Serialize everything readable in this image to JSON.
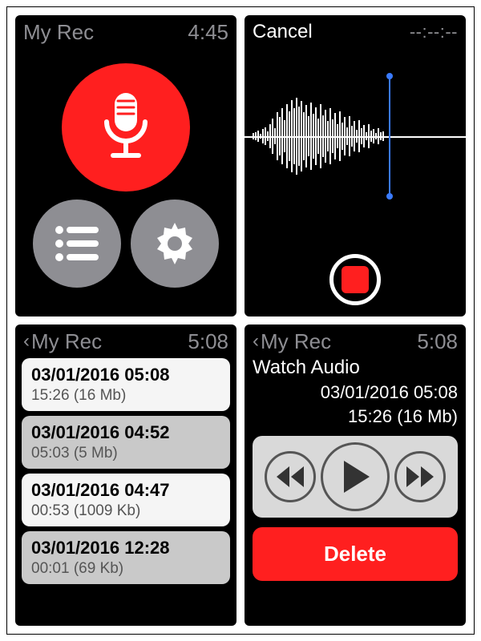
{
  "colors": {
    "accent": "#ff1f1f",
    "grey": "#8e8e93",
    "playhead": "#3a7bff"
  },
  "screen1": {
    "title": "My Rec",
    "time": "4:45",
    "buttons": {
      "record": "record-mic",
      "list": "list",
      "settings": "gear"
    }
  },
  "screen2": {
    "cancel": "Cancel",
    "timecode": "--:--:--"
  },
  "screen3": {
    "back": "My Rec",
    "time": "5:08",
    "items": [
      {
        "date": "03/01/2016 05:08",
        "meta": "15:26 (16 Mb)"
      },
      {
        "date": "03/01/2016 04:52",
        "meta": "05:03 (5 Mb)"
      },
      {
        "date": "03/01/2016 04:47",
        "meta": "00:53 (1009 Kb)"
      },
      {
        "date": "03/01/2016 12:28",
        "meta": "00:01 (69 Kb)"
      }
    ]
  },
  "screen4": {
    "back": "My Rec",
    "time": "5:08",
    "title": "Watch Audio",
    "date": "03/01/2016 05:08",
    "meta": "15:26 (16 Mb)",
    "delete": "Delete"
  }
}
